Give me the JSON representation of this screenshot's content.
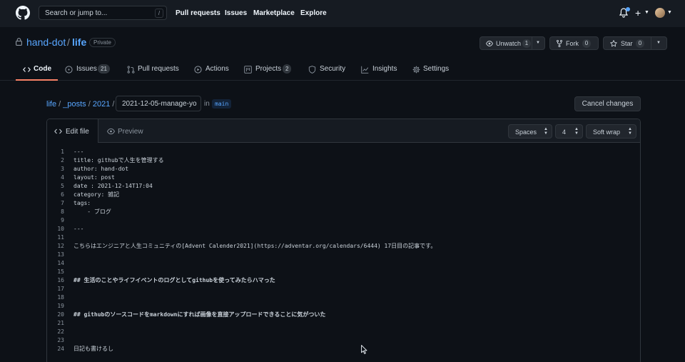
{
  "header": {
    "search_placeholder": "Search or jump to...",
    "search_key": "/",
    "nav": [
      "Pull requests",
      "Issues",
      "Marketplace",
      "Explore"
    ]
  },
  "repo": {
    "owner": "hand-dot",
    "separator": "/",
    "name": "life",
    "visibility": "Private",
    "unwatch_label": "Unwatch",
    "unwatch_count": "1",
    "fork_label": "Fork",
    "fork_count": "0",
    "star_label": "Star",
    "star_count": "0"
  },
  "tabs": [
    {
      "label": "Code",
      "icon": "code-icon",
      "active": true
    },
    {
      "label": "Issues",
      "icon": "issue-icon",
      "count": "21"
    },
    {
      "label": "Pull requests",
      "icon": "pull-request-icon"
    },
    {
      "label": "Actions",
      "icon": "play-icon"
    },
    {
      "label": "Projects",
      "icon": "project-icon",
      "count": "2"
    },
    {
      "label": "Security",
      "icon": "shield-icon"
    },
    {
      "label": "Insights",
      "icon": "graph-icon"
    },
    {
      "label": "Settings",
      "icon": "gear-icon"
    }
  ],
  "breadcrumb": {
    "items": [
      "life",
      "_posts",
      "2021"
    ],
    "separator": "/",
    "filename": "2021-12-05-manage-yo",
    "in_label": "in",
    "branch": "main"
  },
  "cancel_label": "Cancel changes",
  "editor": {
    "edit_tab": "Edit file",
    "preview_tab": "Preview",
    "indent_mode": "Spaces",
    "indent_size": "4",
    "wrap_mode": "Soft wrap",
    "lines": [
      {
        "n": "1",
        "text": "---"
      },
      {
        "n": "2",
        "text": "title: githubで人生を管理する"
      },
      {
        "n": "3",
        "text": "author: hand-dot"
      },
      {
        "n": "4",
        "text": "layout: post"
      },
      {
        "n": "5",
        "text": "date : 2021-12-14T17:04"
      },
      {
        "n": "6",
        "text": "category: 雑記"
      },
      {
        "n": "7",
        "text": "tags:"
      },
      {
        "n": "8",
        "text": "    - ブログ"
      },
      {
        "n": "9",
        "text": ""
      },
      {
        "n": "10",
        "text": "---"
      },
      {
        "n": "11",
        "text": ""
      },
      {
        "n": "12",
        "text": "こちらはエンジニアと人生コミュニティの[Advent Calender2021](https://adventar.org/calendars/6444) 17日目の記事です。"
      },
      {
        "n": "13",
        "text": ""
      },
      {
        "n": "14",
        "text": ""
      },
      {
        "n": "15",
        "text": ""
      },
      {
        "n": "16",
        "text": "## 生活のことやライフイベントのログとしてgithubを使ってみたらハマった"
      },
      {
        "n": "17",
        "text": ""
      },
      {
        "n": "18",
        "text": ""
      },
      {
        "n": "19",
        "text": ""
      },
      {
        "n": "20",
        "text": "## githubのソースコードをmarkdownにすれば画像を直接アップロードできることに気がついた"
      },
      {
        "n": "21",
        "text": ""
      },
      {
        "n": "22",
        "text": ""
      },
      {
        "n": "23",
        "text": ""
      },
      {
        "n": "24",
        "text": "日記も書けるし"
      }
    ]
  }
}
